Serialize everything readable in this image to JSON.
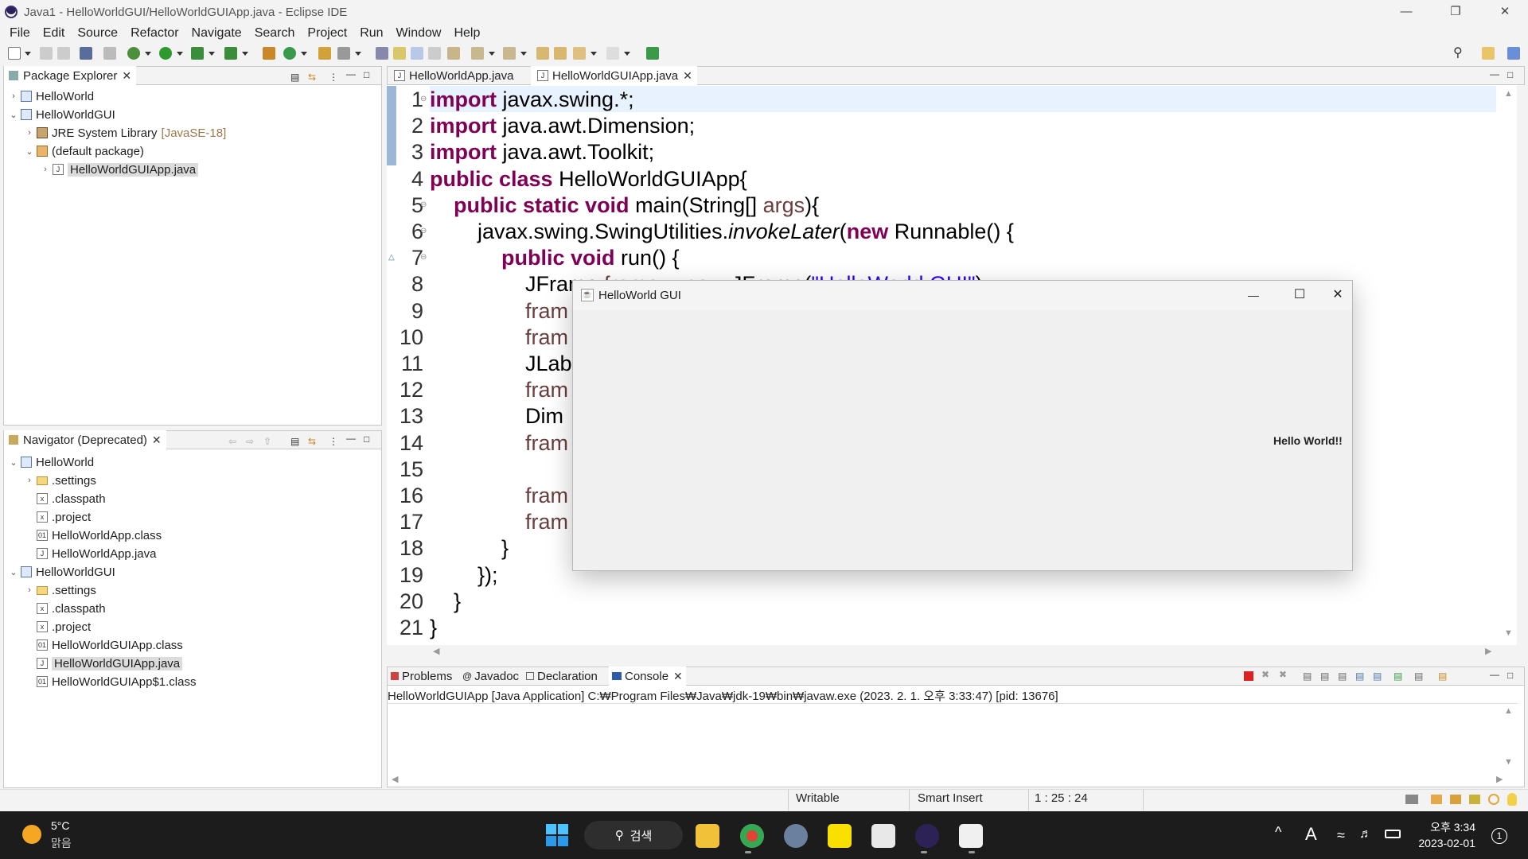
{
  "window": {
    "title": "Java1 - HelloWorldGUI/HelloWorldGUIApp.java - Eclipse IDE"
  },
  "menu": [
    "File",
    "Edit",
    "Source",
    "Refactor",
    "Navigate",
    "Search",
    "Project",
    "Run",
    "Window",
    "Help"
  ],
  "package_explorer": {
    "title": "Package Explorer",
    "items": [
      {
        "label": "HelloWorld",
        "level": 0,
        "chevron": "›",
        "icon": "project"
      },
      {
        "label": "HelloWorldGUI",
        "level": 0,
        "chevron": "⌄",
        "icon": "project"
      },
      {
        "label": "JRE System Library",
        "suffix": "[JavaSE-18]",
        "level": 1,
        "chevron": "›",
        "icon": "library"
      },
      {
        "label": "(default package)",
        "level": 1,
        "chevron": "⌄",
        "icon": "package"
      },
      {
        "label": "HelloWorldGUIApp.java",
        "level": 2,
        "chevron": "›",
        "icon": "java-file",
        "selected": true
      }
    ]
  },
  "navigator": {
    "title": "Navigator (Deprecated)",
    "items": [
      {
        "label": "HelloWorld",
        "level": 0,
        "chevron": "⌄",
        "icon": "project"
      },
      {
        "label": ".settings",
        "level": 1,
        "chevron": "›",
        "icon": "folder"
      },
      {
        "label": ".classpath",
        "level": 1,
        "icon": "file"
      },
      {
        "label": ".project",
        "level": 1,
        "icon": "file"
      },
      {
        "label": "HelloWorldApp.class",
        "level": 1,
        "icon": "class-file"
      },
      {
        "label": "HelloWorldApp.java",
        "level": 1,
        "icon": "java-file"
      },
      {
        "label": "HelloWorldGUI",
        "level": 0,
        "chevron": "⌄",
        "icon": "project"
      },
      {
        "label": ".settings",
        "level": 1,
        "chevron": "›",
        "icon": "folder"
      },
      {
        "label": ".classpath",
        "level": 1,
        "icon": "file"
      },
      {
        "label": ".project",
        "level": 1,
        "icon": "file"
      },
      {
        "label": "HelloWorldGUIApp.class",
        "level": 1,
        "icon": "class-file"
      },
      {
        "label": "HelloWorldGUIApp.java",
        "level": 1,
        "icon": "java-file",
        "selected": true
      },
      {
        "label": "HelloWorldGUIApp$1.class",
        "level": 1,
        "icon": "class-file"
      }
    ]
  },
  "editor": {
    "tabs": [
      {
        "label": "HelloWorldApp.java",
        "active": false
      },
      {
        "label": "HelloWorldGUIApp.java",
        "active": true
      }
    ],
    "lines": [
      [
        {
          "t": "import",
          "c": "kw"
        },
        {
          "t": " javax.swing.*;"
        }
      ],
      [
        {
          "t": "import",
          "c": "kw"
        },
        {
          "t": " java.awt.Dimension;"
        }
      ],
      [
        {
          "t": "import",
          "c": "kw"
        },
        {
          "t": " java.awt.Toolkit;"
        }
      ],
      [
        {
          "t": "public class",
          "c": "kw"
        },
        {
          "t": " HelloWorldGUIApp{"
        }
      ],
      [
        {
          "t": "    "
        },
        {
          "t": "public static void",
          "c": "kw"
        },
        {
          "t": " main(String[] "
        },
        {
          "t": "args",
          "c": "par"
        },
        {
          "t": "){"
        }
      ],
      [
        {
          "t": "        javax.swing.SwingUtilities."
        },
        {
          "t": "invokeLater",
          "c": "it"
        },
        {
          "t": "("
        },
        {
          "t": "new",
          "c": "kw"
        },
        {
          "t": " Runnable() {"
        }
      ],
      [
        {
          "t": "            "
        },
        {
          "t": "public void",
          "c": "kw"
        },
        {
          "t": " run() {"
        }
      ],
      [
        {
          "t": "                JFrame "
        },
        {
          "t": "frame",
          "c": "par"
        },
        {
          "t": " = "
        },
        {
          "t": "new",
          "c": "kw"
        },
        {
          "t": " JFrame("
        },
        {
          "t": "\"HelloWorld GUI\"",
          "c": "str"
        },
        {
          "t": ");"
        }
      ],
      [
        {
          "t": "                "
        },
        {
          "t": "fram",
          "c": "par"
        }
      ],
      [
        {
          "t": "                "
        },
        {
          "t": "fram",
          "c": "par"
        }
      ],
      [
        {
          "t": "                JLab"
        }
      ],
      [
        {
          "t": "                "
        },
        {
          "t": "fram",
          "c": "par"
        }
      ],
      [
        {
          "t": "                Dim"
        }
      ],
      [
        {
          "t": "                "
        },
        {
          "t": "fram",
          "c": "par"
        }
      ],
      [
        {
          "t": ""
        }
      ],
      [
        {
          "t": "                "
        },
        {
          "t": "fram",
          "c": "par"
        }
      ],
      [
        {
          "t": "                "
        },
        {
          "t": "fram",
          "c": "par"
        }
      ],
      [
        {
          "t": "            }"
        }
      ],
      [
        {
          "t": "        });"
        }
      ],
      [
        {
          "t": "    }"
        }
      ],
      [
        {
          "t": "}"
        }
      ]
    ]
  },
  "jframe": {
    "title": "HelloWorld GUI",
    "label": "Hello World!!"
  },
  "bottom": {
    "tabs": [
      "Problems",
      "Javadoc",
      "Declaration",
      "Console"
    ],
    "console_line": "HelloWorldGUIApp [Java Application] C:₩Program Files₩Java₩jdk-19₩bin₩javaw.exe  (2023. 2. 1. 오후 3:33:47) [pid: 13676]"
  },
  "status": {
    "writable": "Writable",
    "insert": "Smart Insert",
    "position": "1 : 25 : 24"
  },
  "taskbar": {
    "weather_temp": "5°C",
    "weather_desc": "맑음",
    "search": "검색",
    "time": "오후 3:34",
    "date": "2023-02-01",
    "notif": "1",
    "ime": "A"
  }
}
